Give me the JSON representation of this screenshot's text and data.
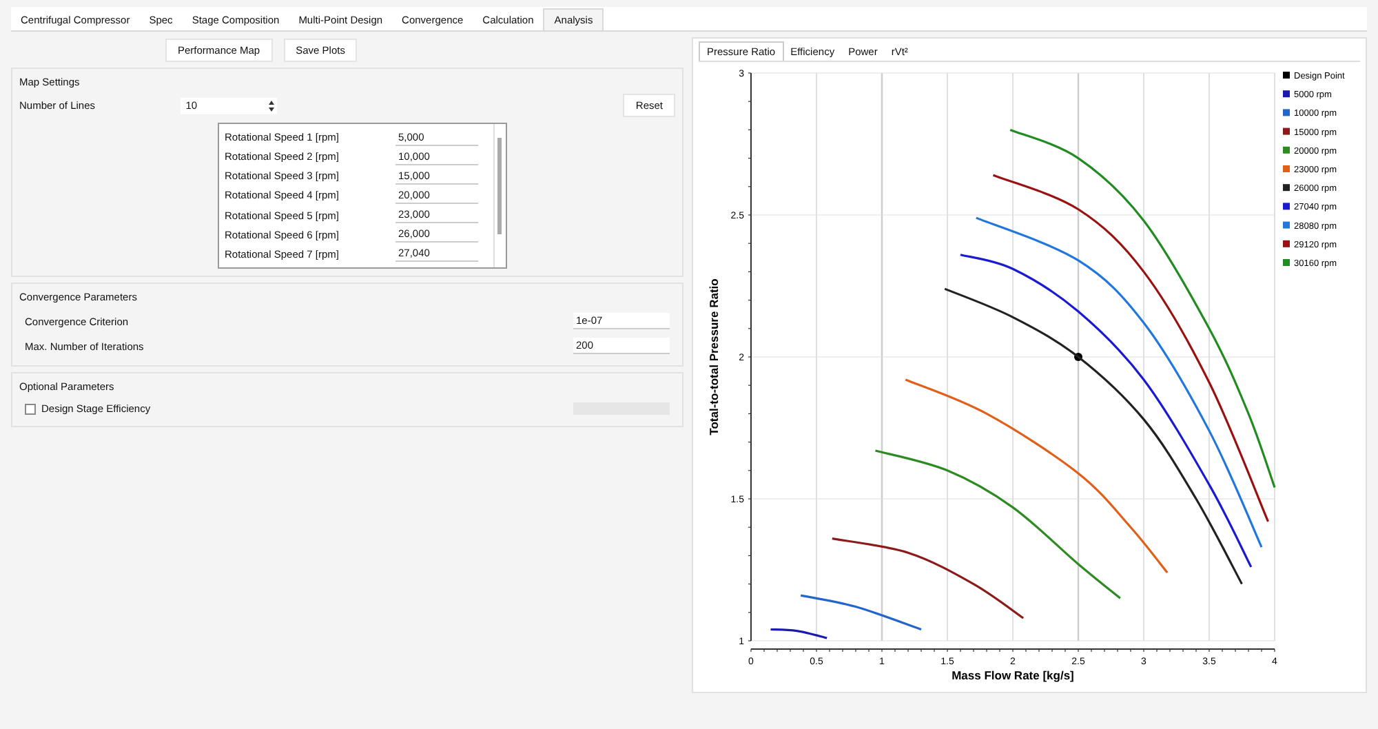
{
  "tabs": [
    {
      "label": "Centrifugal Compressor",
      "selected": false
    },
    {
      "label": "Spec",
      "selected": false
    },
    {
      "label": "Stage Composition",
      "selected": false
    },
    {
      "label": "Multi-Point Design",
      "selected": false
    },
    {
      "label": "Convergence",
      "selected": false
    },
    {
      "label": "Calculation",
      "selected": false
    },
    {
      "label": "Analysis",
      "selected": true
    }
  ],
  "toolbar_buttons": [
    "Performance Map",
    "Save Plots"
  ],
  "map_settings": {
    "title": "Map Settings",
    "number_of_lines": {
      "label": "Number of Lines",
      "value": "10"
    },
    "reset_button": "Reset",
    "speeds": [
      {
        "label": "Rotational Speed 1 [rpm]",
        "value": "5,000"
      },
      {
        "label": "Rotational Speed 2 [rpm]",
        "value": "10,000"
      },
      {
        "label": "Rotational Speed 3 [rpm]",
        "value": "15,000"
      },
      {
        "label": "Rotational Speed 4 [rpm]",
        "value": "20,000"
      },
      {
        "label": "Rotational Speed 5 [rpm]",
        "value": "23,000"
      },
      {
        "label": "Rotational Speed 6 [rpm]",
        "value": "26,000"
      },
      {
        "label": "Rotational Speed 7 [rpm]",
        "value": "27,040"
      }
    ]
  },
  "convergence_parameters": {
    "title": "Convergence Parameters",
    "fields": [
      {
        "label": "Convergence Criterion",
        "value": "1e-07"
      },
      {
        "label": "Max. Number of Iterations",
        "value": "200"
      }
    ]
  },
  "optional_parameters": {
    "title": "Optional Parameters",
    "design_stage_efficiency": {
      "label": "Design Stage Efficiency",
      "checked": false,
      "field_disabled": true
    }
  },
  "chart_panel": {
    "tabs": [
      {
        "label": "Pressure Ratio",
        "selected": true
      },
      {
        "label": "Efficiency",
        "selected": false
      },
      {
        "label": "Power",
        "selected": false
      },
      {
        "label": "rVt²",
        "selected": false
      }
    ],
    "chart_data": {
      "type": "line",
      "grid": true,
      "legend": true,
      "xlabel": "Mass Flow Rate  [kg/s]",
      "ylabel": "Total-to-total Pressure Ratio",
      "xlim": [
        0,
        4
      ],
      "ylim": [
        1,
        3
      ],
      "xticks": [
        0,
        0.5,
        1,
        1.5,
        2,
        2.5,
        3,
        3.5,
        4
      ],
      "yticks": [
        1,
        1.5,
        2,
        2.5,
        3
      ],
      "series": [
        {
          "name": "Design Point",
          "marker": "circle",
          "color": "#000000",
          "x": [
            2.5
          ],
          "values": [
            2.0
          ]
        },
        {
          "name": "5000 rpm",
          "color": "#1a1ab0",
          "x": [
            0.15,
            0.35,
            0.58
          ],
          "values": [
            1.04,
            1.035,
            1.01
          ]
        },
        {
          "name": "10000 rpm",
          "color": "#2266cc",
          "x": [
            0.38,
            0.8,
            1.3
          ],
          "values": [
            1.16,
            1.12,
            1.04
          ]
        },
        {
          "name": "15000 rpm",
          "color": "#8b1a1a",
          "x": [
            0.62,
            1.2,
            1.7,
            2.08
          ],
          "values": [
            1.36,
            1.31,
            1.2,
            1.08
          ]
        },
        {
          "name": "20000 rpm",
          "color": "#2e8b22",
          "x": [
            0.95,
            1.5,
            2.0,
            2.5,
            2.82
          ],
          "values": [
            1.67,
            1.6,
            1.47,
            1.27,
            1.15
          ]
        },
        {
          "name": "23000 rpm",
          "color": "#e0601a",
          "x": [
            1.18,
            1.8,
            2.5,
            2.9,
            3.18
          ],
          "values": [
            1.92,
            1.8,
            1.59,
            1.4,
            1.24
          ]
        },
        {
          "name": "26000 rpm",
          "color": "#222222",
          "x": [
            1.48,
            2.0,
            2.5,
            3.0,
            3.4,
            3.75
          ],
          "values": [
            2.24,
            2.14,
            2.0,
            1.78,
            1.5,
            1.2
          ]
        },
        {
          "name": "27040 rpm",
          "color": "#1a1ad0",
          "x": [
            1.6,
            2.0,
            2.5,
            3.0,
            3.5,
            3.82
          ],
          "values": [
            2.36,
            2.31,
            2.16,
            1.92,
            1.55,
            1.26
          ]
        },
        {
          "name": "28080 rpm",
          "color": "#2277dd",
          "x": [
            1.72,
            2.5,
            3.0,
            3.5,
            3.9
          ],
          "values": [
            2.49,
            2.34,
            2.12,
            1.74,
            1.33
          ]
        },
        {
          "name": "29120 rpm",
          "color": "#991111",
          "x": [
            1.85,
            2.5,
            3.0,
            3.5,
            3.95
          ],
          "values": [
            2.64,
            2.52,
            2.3,
            1.91,
            1.42
          ]
        },
        {
          "name": "30160 rpm",
          "color": "#228b22",
          "x": [
            1.98,
            2.5,
            3.0,
            3.5,
            3.8,
            4.0
          ],
          "values": [
            2.8,
            2.7,
            2.48,
            2.1,
            1.8,
            1.54
          ]
        }
      ]
    }
  }
}
